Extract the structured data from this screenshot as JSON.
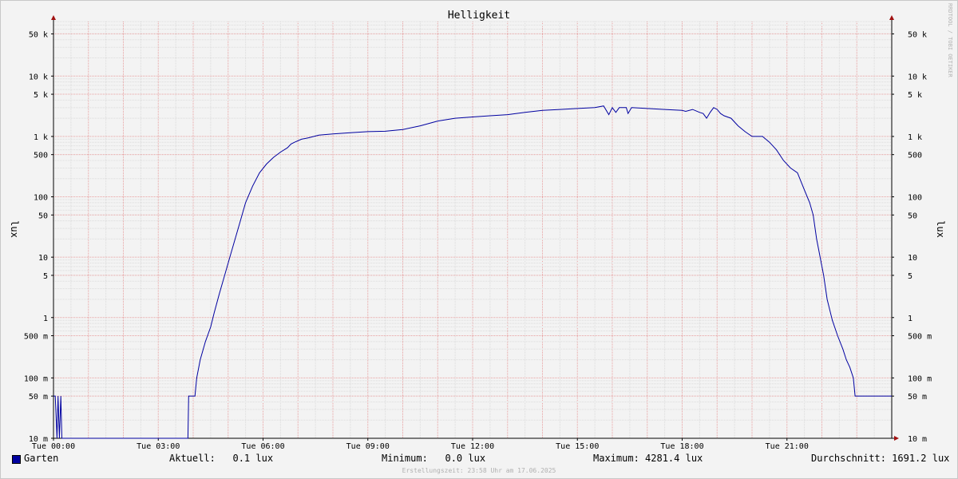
{
  "chart_data": {
    "type": "line",
    "title": "Helligkeit",
    "ylabel": "lux",
    "y_scale": "log",
    "ylim": [
      10,
      80000
    ],
    "x_range_hours": [
      0,
      24
    ],
    "x_ticks": [
      {
        "h": 0,
        "label": "Tue 00:00"
      },
      {
        "h": 3,
        "label": "Tue 03:00"
      },
      {
        "h": 6,
        "label": "Tue 06:00"
      },
      {
        "h": 9,
        "label": "Tue 09:00"
      },
      {
        "h": 12,
        "label": "Tue 12:00"
      },
      {
        "h": 15,
        "label": "Tue 15:00"
      },
      {
        "h": 18,
        "label": "Tue 18:00"
      },
      {
        "h": 21,
        "label": "Tue 21:00"
      }
    ],
    "y_ticks": [
      {
        "v": 50000,
        "label": "50 k"
      },
      {
        "v": 10000,
        "label": "10 k"
      },
      {
        "v": 5000,
        "label": "5 k"
      },
      {
        "v": 1000,
        "label": "1 k"
      },
      {
        "v": 500,
        "label": "500"
      },
      {
        "v": 100,
        "label": "100"
      },
      {
        "v": 50,
        "label": "50"
      },
      {
        "v": 10,
        "label": "10"
      },
      {
        "v": 5,
        "label": "5"
      },
      {
        "v": 1,
        "label": "1"
      },
      {
        "v": 0.5,
        "label": "500 m"
      },
      {
        "v": 0.1,
        "label": "100 m"
      },
      {
        "v": 0.05,
        "label": "50 m"
      },
      {
        "v": 0.01,
        "label": "10 m"
      }
    ],
    "series": [
      {
        "name": "Garten",
        "color": "#0000a0",
        "points": [
          [
            0.0,
            0.05
          ],
          [
            0.05,
            0.05
          ],
          [
            0.1,
            0.01
          ],
          [
            0.13,
            0.05
          ],
          [
            0.17,
            0.01
          ],
          [
            0.21,
            0.05
          ],
          [
            0.24,
            0.01
          ],
          [
            3.85,
            0.01
          ],
          [
            3.87,
            0.05
          ],
          [
            4.05,
            0.05
          ],
          [
            4.1,
            0.1
          ],
          [
            4.2,
            0.2
          ],
          [
            4.35,
            0.4
          ],
          [
            4.5,
            0.7
          ],
          [
            4.6,
            1.2
          ],
          [
            4.75,
            2.5
          ],
          [
            4.9,
            5
          ],
          [
            5.05,
            10
          ],
          [
            5.2,
            20
          ],
          [
            5.35,
            40
          ],
          [
            5.5,
            80
          ],
          [
            5.7,
            150
          ],
          [
            5.9,
            250
          ],
          [
            6.1,
            350
          ],
          [
            6.3,
            450
          ],
          [
            6.5,
            550
          ],
          [
            6.7,
            650
          ],
          [
            6.8,
            750
          ],
          [
            6.9,
            800
          ],
          [
            7.1,
            900
          ],
          [
            7.3,
            950
          ],
          [
            7.6,
            1050
          ],
          [
            8.0,
            1100
          ],
          [
            8.5,
            1150
          ],
          [
            9.0,
            1200
          ],
          [
            9.5,
            1220
          ],
          [
            10.0,
            1300
          ],
          [
            10.5,
            1500
          ],
          [
            11.0,
            1800
          ],
          [
            11.5,
            2000
          ],
          [
            12.0,
            2100
          ],
          [
            12.5,
            2200
          ],
          [
            13.0,
            2300
          ],
          [
            13.5,
            2500
          ],
          [
            14.0,
            2700
          ],
          [
            14.5,
            2800
          ],
          [
            15.0,
            2900
          ],
          [
            15.5,
            3000
          ],
          [
            15.75,
            3200
          ],
          [
            15.9,
            2300
          ],
          [
            16.0,
            3000
          ],
          [
            16.1,
            2500
          ],
          [
            16.2,
            3000
          ],
          [
            16.4,
            3000
          ],
          [
            16.45,
            2400
          ],
          [
            16.55,
            3000
          ],
          [
            17.0,
            2900
          ],
          [
            17.5,
            2800
          ],
          [
            18.0,
            2700
          ],
          [
            18.1,
            2600
          ],
          [
            18.3,
            2800
          ],
          [
            18.5,
            2500
          ],
          [
            18.6,
            2400
          ],
          [
            18.7,
            2000
          ],
          [
            18.8,
            2500
          ],
          [
            18.9,
            3000
          ],
          [
            19.0,
            2800
          ],
          [
            19.1,
            2400
          ],
          [
            19.2,
            2200
          ],
          [
            19.4,
            2000
          ],
          [
            19.6,
            1500
          ],
          [
            19.8,
            1200
          ],
          [
            20.0,
            1000
          ],
          [
            20.3,
            1000
          ],
          [
            20.5,
            800
          ],
          [
            20.7,
            600
          ],
          [
            20.9,
            400
          ],
          [
            21.1,
            300
          ],
          [
            21.3,
            250
          ],
          [
            21.5,
            130
          ],
          [
            21.65,
            80
          ],
          [
            21.75,
            50
          ],
          [
            21.85,
            20
          ],
          [
            21.95,
            10
          ],
          [
            22.05,
            5
          ],
          [
            22.15,
            2
          ],
          [
            22.3,
            0.9
          ],
          [
            22.45,
            0.5
          ],
          [
            22.6,
            0.3
          ],
          [
            22.7,
            0.2
          ],
          [
            22.8,
            0.15
          ],
          [
            22.9,
            0.1
          ],
          [
            22.95,
            0.05
          ],
          [
            24.0,
            0.05
          ]
        ]
      }
    ]
  },
  "legend": {
    "series_name": "Garten",
    "aktuell": "Aktuell:   0.1 lux",
    "minimum": "Minimum:   0.0 lux",
    "maximum": "Maximum: 4281.4 lux",
    "durchschnitt": "Durchschnitt: 1691.2 lux"
  },
  "footer": "Erstellungszeit: 23:58 Uhr am 17.06.2025",
  "watermark": "RRDTOOL / TOBI OETIKER",
  "colors": {
    "line": "#0000a0",
    "minor_grid": "#dcdcdc",
    "major_grid": "#e8a0a0",
    "arrow": "#a01010"
  }
}
